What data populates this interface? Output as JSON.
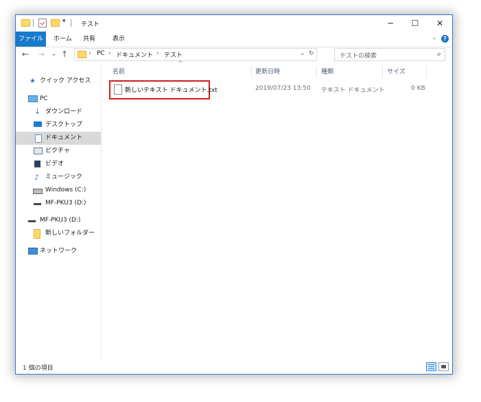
{
  "titlebar": {
    "title": "テスト",
    "minimize": "─",
    "maximize": "☐",
    "close": "✕",
    "qa_dropdown": "▾"
  },
  "ribbon": {
    "tabs": [
      "ファイル",
      "ホーム",
      "共有",
      "表示"
    ],
    "expand": "⌄",
    "help": "?"
  },
  "nav": {
    "back": "←",
    "forward": "→",
    "recent": "⌄",
    "up": "↑",
    "breadcrumb": [
      "PC",
      "ドキュメント",
      "テスト"
    ],
    "crumb_sep": "›",
    "dropdown": "⌄",
    "refresh": "↻",
    "search_placeholder": "テストの検索",
    "search_icon": "⌕"
  },
  "sidebar": {
    "items": [
      {
        "label": "クイック アクセス",
        "icon": "star-icon"
      },
      {
        "label": "PC",
        "icon": "pc-icon"
      },
      {
        "label": "ダウンロード",
        "icon": "download-icon"
      },
      {
        "label": "デスクトップ",
        "icon": "desktop-icon"
      },
      {
        "label": "ドキュメント",
        "icon": "document-icon"
      },
      {
        "label": "ピクチャ",
        "icon": "pictures-icon"
      },
      {
        "label": "ビデオ",
        "icon": "video-icon"
      },
      {
        "label": "ミュージック",
        "icon": "music-icon"
      },
      {
        "label": "Windows (C:)",
        "icon": "drive-icon"
      },
      {
        "label": "MF-PKU3 (D:)",
        "icon": "usb-drive-icon"
      },
      {
        "label": "MF-PKU3 (D:)",
        "icon": "usb-drive-icon"
      },
      {
        "label": "新しいフォルダー",
        "icon": "folder-icon"
      },
      {
        "label": "ネットワーク",
        "icon": "network-icon"
      }
    ]
  },
  "columns": {
    "name": "名前",
    "modified": "更新日時",
    "type": "種類",
    "size": "サイズ",
    "sort_arrow": "^"
  },
  "files": [
    {
      "name": "新しいテキスト ドキュメント.txt",
      "modified": "2019/07/23 13:50",
      "type": "テキスト ドキュメント",
      "size": "0 KB"
    }
  ],
  "status": {
    "count": "1 個の項目"
  },
  "colors": {
    "accent": "#1979ca",
    "highlight_border": "#d11b1b",
    "selected_nav": "#d9d9d9"
  }
}
